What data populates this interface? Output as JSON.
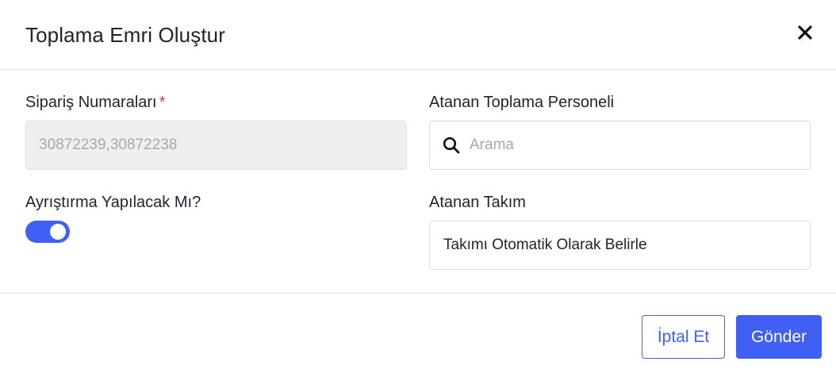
{
  "dialog": {
    "title": "Toplama Emri Oluştur"
  },
  "form": {
    "order_numbers": {
      "label": "Sipariş Numaraları",
      "required_marker": "*",
      "value": "30872239,30872238"
    },
    "picker": {
      "label": "Atanan Toplama Personeli",
      "placeholder": "Arama",
      "icon": "search-icon"
    },
    "separation": {
      "label": "Ayrıştırma Yapılacak Mı?",
      "enabled": true
    },
    "team": {
      "label": "Atanan Takım",
      "value": "Takımı Otomatik Olarak Belirle"
    }
  },
  "actions": {
    "cancel_label": "İptal Et",
    "submit_label": "Gönder"
  },
  "colors": {
    "accent": "#3f5ff5",
    "required": "#e53935",
    "disabled_bg": "#efefef"
  }
}
